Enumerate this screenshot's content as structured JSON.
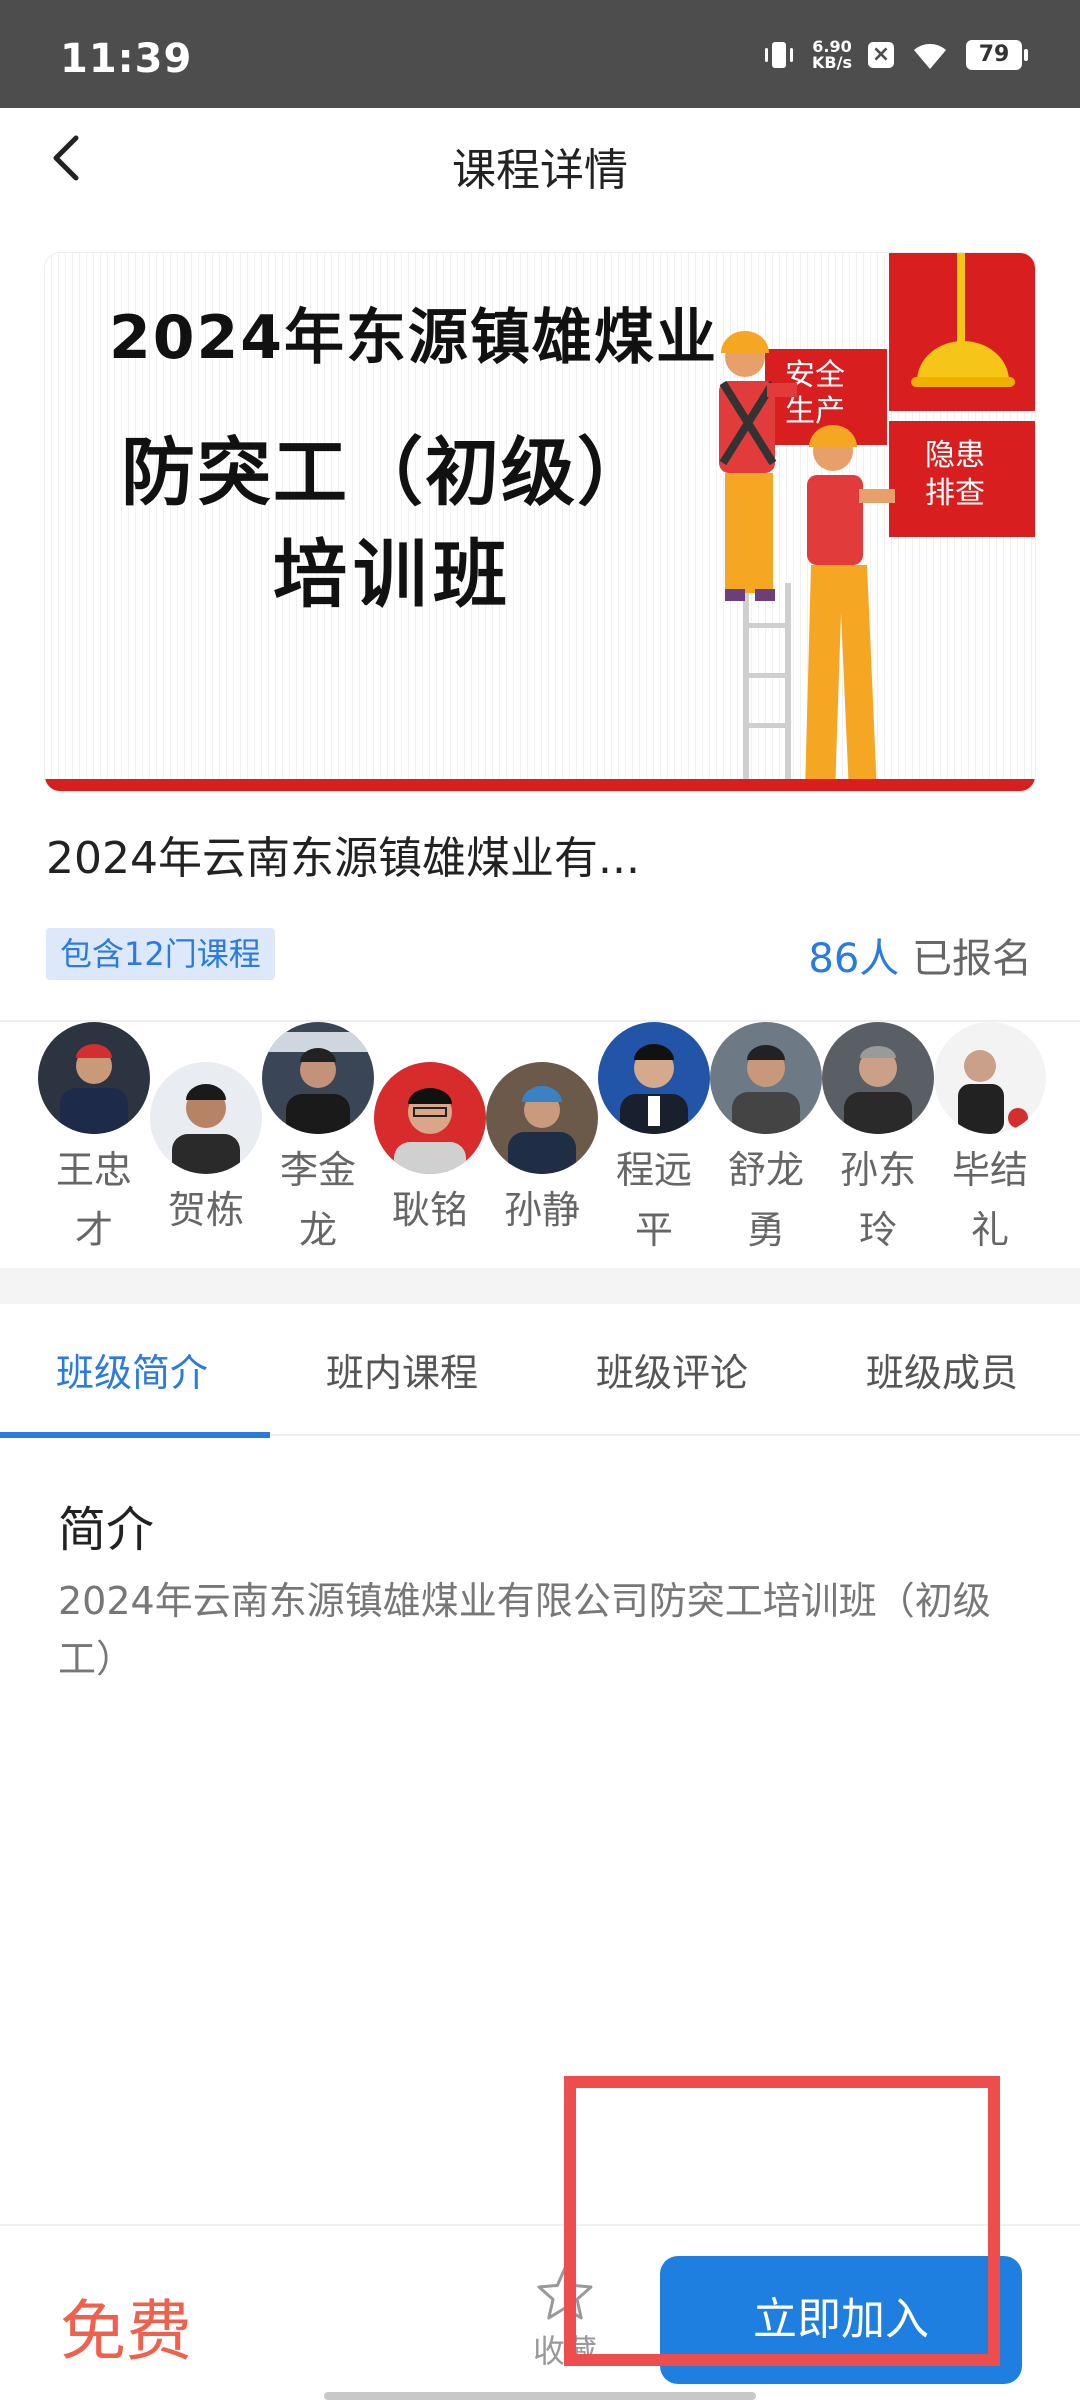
{
  "status_bar": {
    "time": "11:39",
    "net_speed_value": "6.90",
    "net_speed_unit": "KB/s",
    "battery": "79",
    "icons": [
      "vibrate-icon",
      "close-notification-icon",
      "wifi-icon",
      "battery-icon"
    ]
  },
  "nav": {
    "title": "课程详情",
    "back_icon": "back-arrow-icon"
  },
  "banner": {
    "line1": "2024年东源镇雄煤业",
    "line2": "防突工（初级）",
    "line3": "培训班",
    "sign1_top": "安全",
    "sign1_bottom": "生产",
    "sign2_top": "隐患",
    "sign2_bottom": "排查"
  },
  "course": {
    "title": "2024年云南东源镇雄煤业有...",
    "badge": "包含12门课程",
    "enroll_count": "86人",
    "enroll_suffix": " 已报名"
  },
  "teachers": [
    {
      "name": "王忠才"
    },
    {
      "name": "贺栋"
    },
    {
      "name": "李金龙"
    },
    {
      "name": "耿铭"
    },
    {
      "name": "孙静"
    },
    {
      "name": "程远平"
    },
    {
      "name": "舒龙勇"
    },
    {
      "name": "孙东玲"
    },
    {
      "name": "毕结礼"
    }
  ],
  "tabs": [
    "班级简介",
    "班内课程",
    "班级评论",
    "班级成员"
  ],
  "intro": {
    "heading": "简介",
    "text": "2024年云南东源镇雄煤业有限公司防突工培训班（初级工）"
  },
  "bottom_bar": {
    "price": "免费",
    "favorite_label": "收藏",
    "join_label": "立即加入"
  },
  "colors": {
    "accent": "#1f7fe0",
    "price": "#f0614d",
    "highlight": "#ee4d4d",
    "status_bar": "#4d4d4d"
  }
}
